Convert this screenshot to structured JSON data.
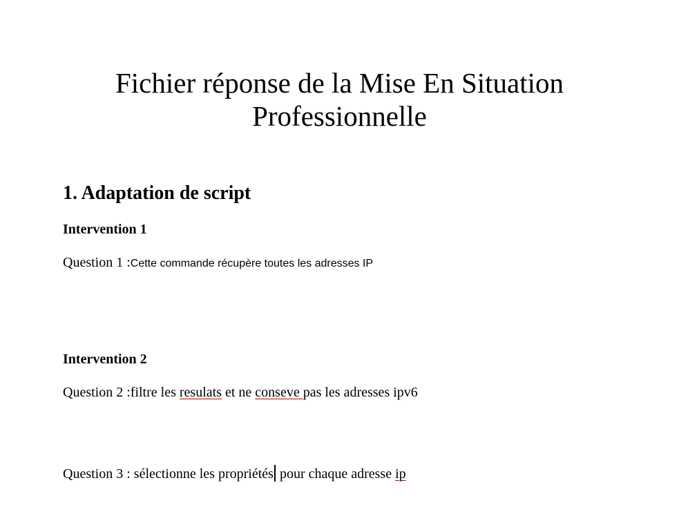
{
  "document": {
    "title_line1": "Fichier réponse de la Mise En Situation",
    "title_line2": "Professionnelle",
    "section1": {
      "heading": "1. Adaptation de script",
      "intervention1": {
        "heading": "Intervention 1",
        "q1_label": "Question 1 :",
        "q1_answer": "Cette commande récupère toutes les adresses IP"
      },
      "intervention2": {
        "heading": "Intervention 2",
        "q2_label": "Question 2 :",
        "q2_part1": "filtre les ",
        "q2_misspelled1": "resulats",
        "q2_part2": " et ne ",
        "q2_misspelled2": "conseve ",
        "q2_part3": "pas les adresses ipv6",
        "q3_label": "Question 3 : ",
        "q3_part1": "sélectionne les propriétés",
        "q3_part2": " pour chaque adresse ",
        "q3_misspelled": "ip"
      }
    }
  }
}
